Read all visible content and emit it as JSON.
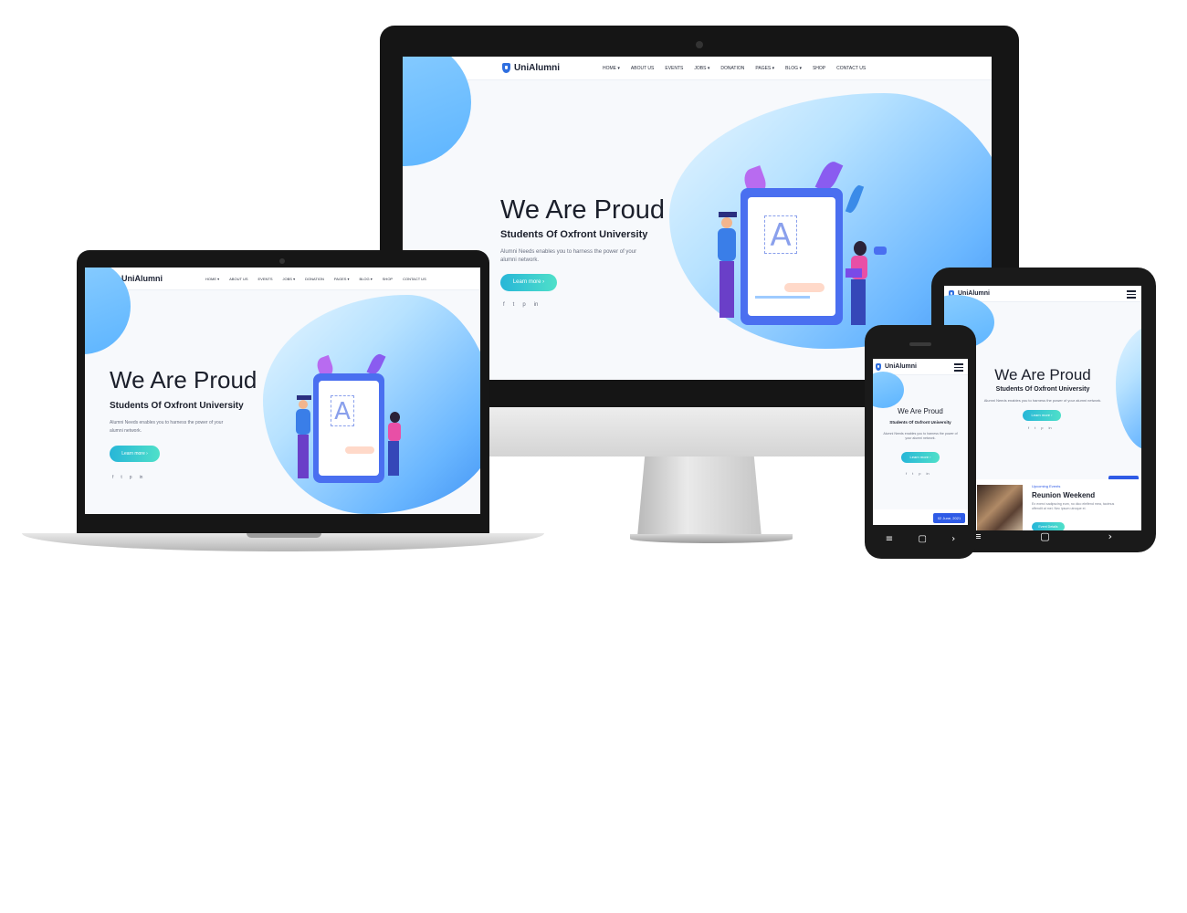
{
  "site": {
    "brand": "UniAlumni",
    "menu": [
      "HOME ▾",
      "ABOUT US",
      "EVENTS",
      "JOBS ▾",
      "DONATION",
      "PAGES ▾",
      "BLOG ▾",
      "SHOP",
      "CONTACT US"
    ],
    "hero": {
      "title": "We Are Proud",
      "subtitle": "Students Of Oxfront University",
      "description": "Alumni Needs enables you to harness the power of your alumni network.",
      "button": "Learn more ›"
    },
    "socials": [
      "f",
      "t",
      "p",
      "in"
    ]
  },
  "event": {
    "label": "Upcoming Events",
    "title": "Reunion Weekend",
    "text": "Ex exerci sadipscing eum, no dico eleifend mea, tacimus offendit at mei. Nec ipsum utroque ei.",
    "date": "02 June, 2021",
    "button": "Event Details"
  },
  "softkeys": {
    "phone": [
      "≡",
      "▢",
      "›"
    ],
    "tablet": [
      "≡",
      "▢",
      "›"
    ]
  },
  "colors": {
    "brand_blue": "#2f6fe0",
    "button_gradient_start": "#27b6d8",
    "button_gradient_end": "#4fe0c9",
    "blob": "#69b6ff",
    "date_badge": "#2f5be6"
  }
}
